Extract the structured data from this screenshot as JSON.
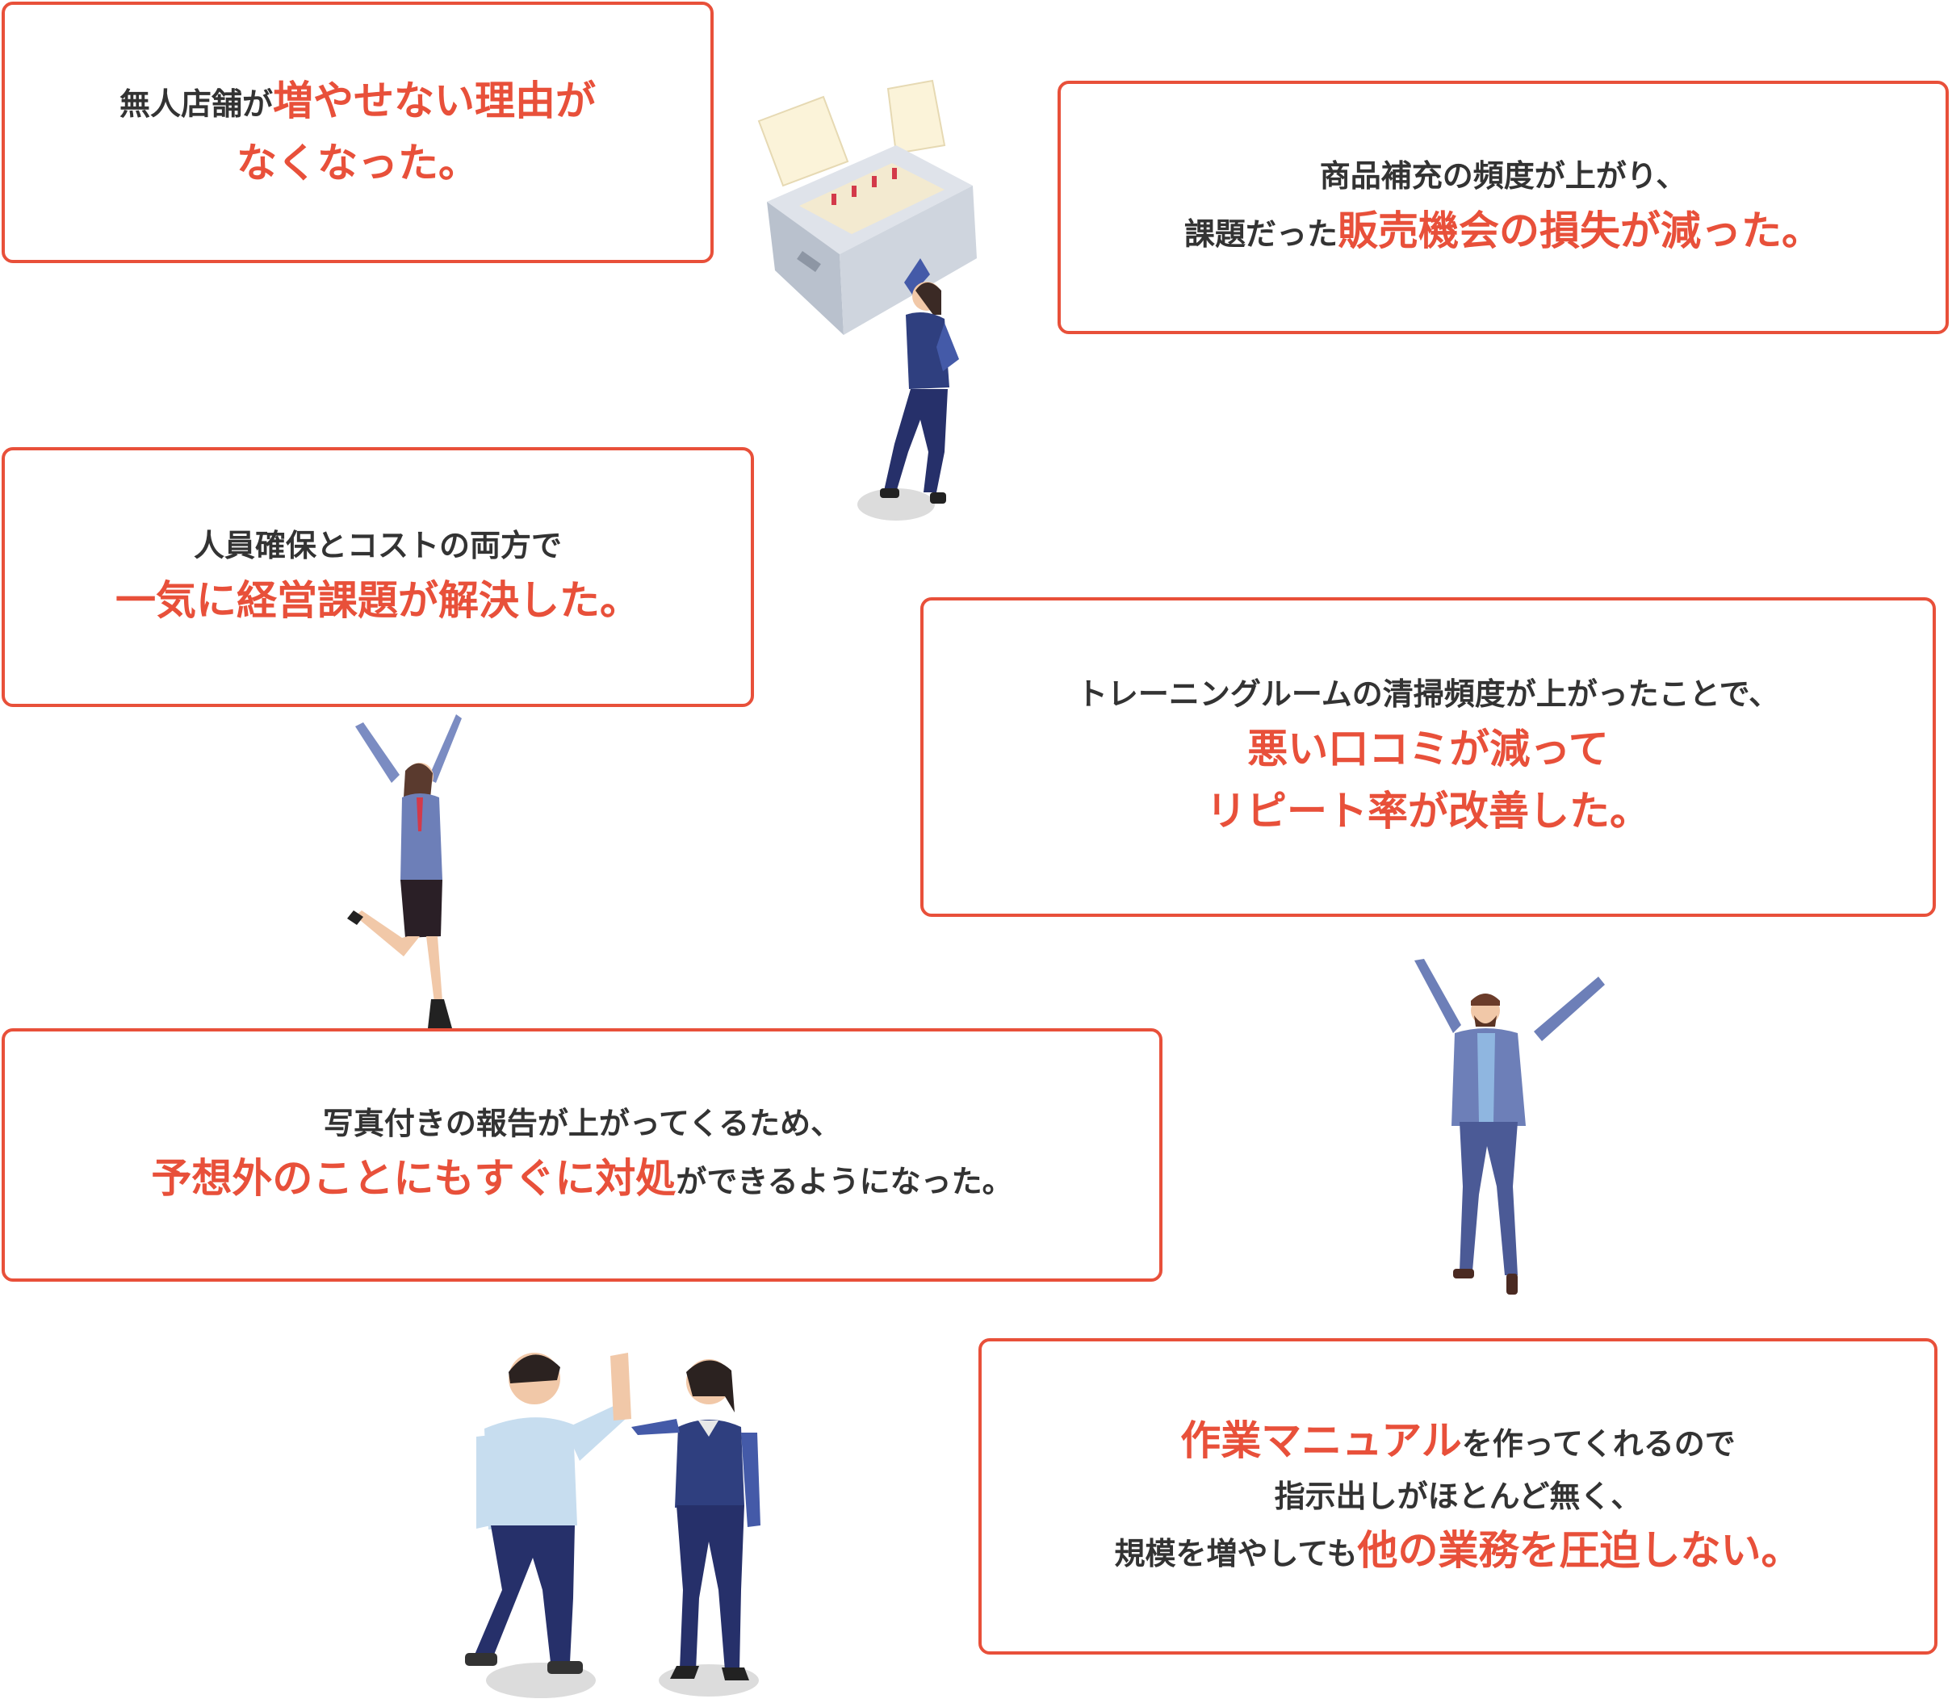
{
  "accent_color": "#e8503a",
  "cards": [
    {
      "l1a": "無人店舗が",
      "l1b": "増やせない理由が",
      "l2": "なくなった。"
    },
    {
      "l1": "商品補充の頻度が上がり、",
      "l2a": "課題だった",
      "l2b": "販売機会の損失が減った。"
    },
    {
      "l1": "人員確保とコストの両方で",
      "l2": "一気に経営課題が解決した。"
    },
    {
      "l1": "トレーニングルームの清掃頻度が上がったことで、",
      "l2": "悪い口コミが減って",
      "l3": "リピート率が改善した。"
    },
    {
      "l1": "写真付きの報告が上がってくるため、",
      "l2a": "予想外のことにもすぐに対処",
      "l2b": "ができるようになった。"
    },
    {
      "l1a": "作業マニュアル",
      "l1b": "を作ってくれるので",
      "l2": "指示出しがほとんど無く、",
      "l3a": "規模を増やしても",
      "l3b": "他の業務を圧迫しない。"
    }
  ],
  "illustrations": [
    "file-drawer-woman-illustration",
    "jumping-woman-illustration",
    "cheering-man-illustration",
    "high-five-illustration"
  ]
}
